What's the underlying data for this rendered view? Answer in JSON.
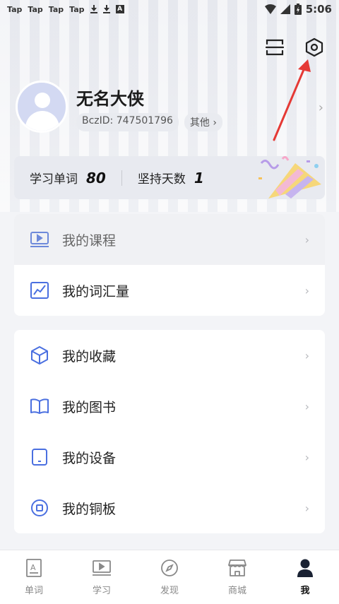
{
  "status_bar": {
    "left_items": [
      "Tap",
      "Tap",
      "Tap",
      "Tap"
    ],
    "time": "5:06",
    "icons": [
      "download-icon",
      "download-icon",
      "a-icon",
      "wifi-icon",
      "signal-icon",
      "battery-icon"
    ]
  },
  "header": {
    "icons": [
      "scan-icon",
      "settings-icon"
    ]
  },
  "profile": {
    "name": "无名大侠",
    "bcz_id": "BczID: 747501796",
    "other_label": "其他",
    "other_chevron": "›",
    "chevron": "›"
  },
  "stats": {
    "words_label": "学习单词",
    "words_value": "80",
    "days_label": "坚持天数",
    "days_value": "1"
  },
  "menu_group_1": [
    {
      "label": "我的课程",
      "icon": "video-lesson-icon"
    },
    {
      "label": "我的词汇量",
      "icon": "chart-icon"
    }
  ],
  "menu_group_2": [
    {
      "label": "我的收藏",
      "icon": "cube-icon"
    },
    {
      "label": "我的图书",
      "icon": "book-icon"
    },
    {
      "label": "我的设备",
      "icon": "device-icon"
    },
    {
      "label": "我的铜板",
      "icon": "coin-icon"
    }
  ],
  "chevron": "›",
  "tabbar": {
    "tabs": [
      {
        "label": "单词",
        "icon": "word-card-icon"
      },
      {
        "label": "学习",
        "icon": "study-icon"
      },
      {
        "label": "发现",
        "icon": "compass-icon"
      },
      {
        "label": "商城",
        "icon": "store-icon"
      },
      {
        "label": "我",
        "icon": "person-icon"
      }
    ],
    "active_index": 4
  },
  "colors": {
    "accent": "#4a6fe0",
    "annotation_arrow": "#e53935"
  }
}
